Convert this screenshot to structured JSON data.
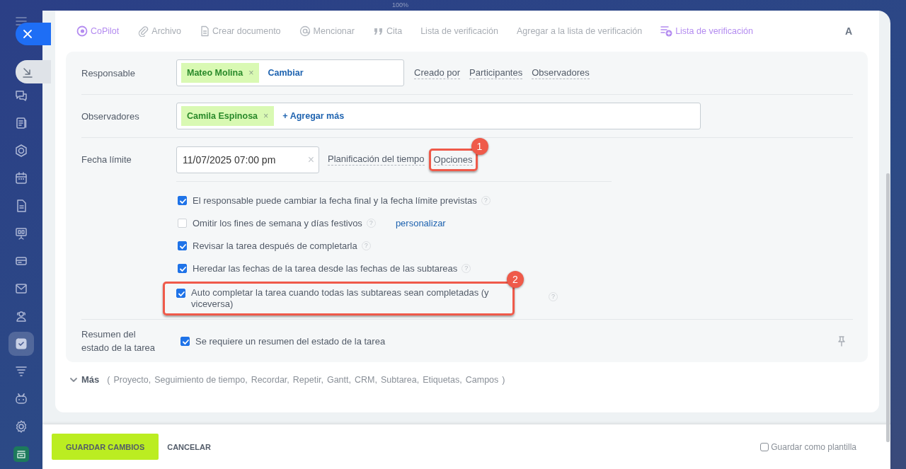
{
  "zoom_label": "100%",
  "sidebar": {
    "items": [
      {
        "kind": "menu",
        "selected": false
      },
      {
        "kind": "chat",
        "selected": false
      },
      {
        "kind": "news",
        "selected": false
      },
      {
        "kind": "hexagon",
        "selected": false
      },
      {
        "kind": "calendar",
        "selected": false
      },
      {
        "kind": "document",
        "selected": false
      },
      {
        "kind": "board",
        "selected": false
      },
      {
        "kind": "card",
        "selected": false
      },
      {
        "kind": "mail",
        "selected": false
      },
      {
        "kind": "people",
        "selected": false
      },
      {
        "kind": "tasks",
        "selected": true
      },
      {
        "kind": "funnel",
        "selected": false
      },
      {
        "kind": "robot",
        "selected": false
      },
      {
        "kind": "gear",
        "selected": false
      },
      {
        "kind": "app",
        "selected": false
      }
    ]
  },
  "toolbar": {
    "items": [
      {
        "kind": "copilot",
        "label": "CoPilot",
        "highlighted": true
      },
      {
        "kind": "clip",
        "label": "Archivo",
        "highlighted": false
      },
      {
        "kind": "doc",
        "label": "Crear documento",
        "highlighted": false
      },
      {
        "kind": "at",
        "label": "Mencionar",
        "highlighted": false
      },
      {
        "kind": "quote",
        "label": "Cita",
        "highlighted": false
      },
      {
        "kind": "plain",
        "label": "Lista de verificación",
        "highlighted": false
      },
      {
        "kind": "plain",
        "label": "Agregar a la lista de verificación",
        "highlighted": false
      },
      {
        "kind": "checklist",
        "label": "Lista de verificación",
        "highlighted": true
      }
    ],
    "format": "A"
  },
  "form": {
    "responsible": {
      "label": "Responsable",
      "tags": [
        {
          "name": "Mateo Molina",
          "remove": "×"
        }
      ],
      "action": "Cambiar",
      "links": [
        "Creado por",
        "Participantes",
        "Observadores"
      ]
    },
    "observers": {
      "label": "Observadores",
      "tags": [
        {
          "name": "Camila Espinosa",
          "remove": "×"
        }
      ],
      "action": "+ Agregar más"
    },
    "deadline": {
      "label": "Fecha límite",
      "value": "11/07/2025 07:00 pm",
      "clear": "×",
      "links": [
        {
          "label": "Planificación del tiempo"
        },
        {
          "label": "Opciones",
          "callout": "1"
        }
      ]
    },
    "options": [
      {
        "label": "El responsable puede cambiar la fecha final y la fecha límite previstas",
        "checked": true,
        "help": "?"
      },
      {
        "label": "Omitir los fines de semana y días festivos",
        "checked": false,
        "help": "?",
        "link": "personalizar"
      },
      {
        "label": "Revisar la tarea después de completarla",
        "checked": true,
        "help": "?"
      },
      {
        "label": "Heredar las fechas de la tarea desde las fechas de las subtareas",
        "checked": true,
        "help": "?"
      },
      {
        "label": "Auto completar la tarea cuando todas las subtareas sean completadas (y viceversa)",
        "checked": true,
        "help": "?",
        "callout": "2"
      }
    ],
    "summary": {
      "label": "Resumen del estado de la tarea",
      "option": {
        "label": "Se requiere un resumen del estado de la tarea",
        "checked": true
      }
    }
  },
  "more": {
    "label": "Más",
    "open": "(",
    "items": [
      "Proyecto,",
      "Seguimiento de tiempo,",
      "Recordar,",
      "Repetir,",
      "Gantt,",
      "CRM,",
      "Subtarea,",
      "Etiquetas,",
      "Campos"
    ],
    "close": ")"
  },
  "footer": {
    "save": "GUARDAR CAMBIOS",
    "cancel": "CANCELAR",
    "template": {
      "label": "Guardar como plantilla",
      "checked": false
    }
  }
}
